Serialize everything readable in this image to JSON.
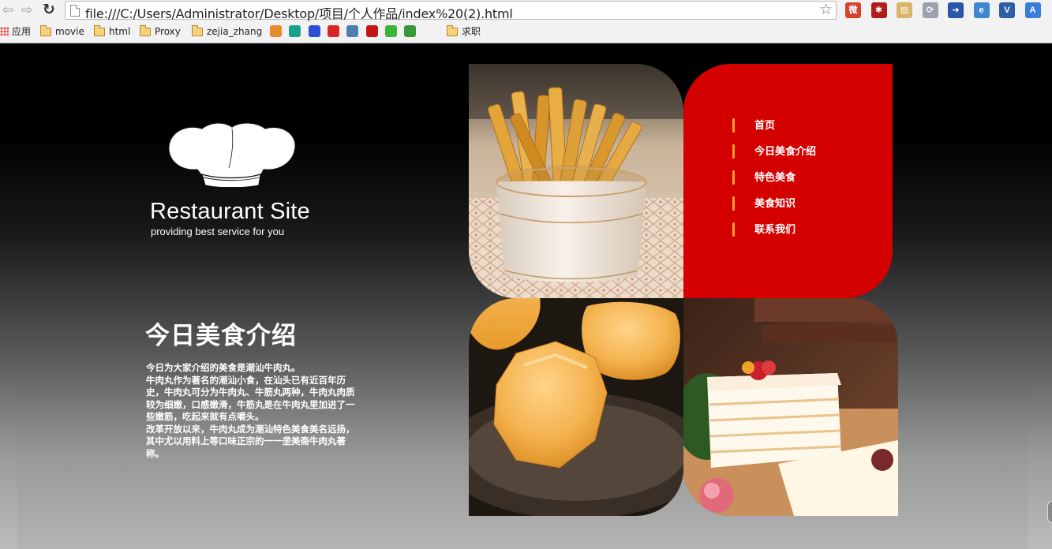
{
  "browser": {
    "url": "file:///C:/Users/Administrator/Desktop/项目/个人作品/index%20(2).html",
    "back_icon": "back-arrow-icon",
    "forward_icon": "forward-arrow-icon",
    "reload_icon": "reload-icon",
    "star_icon": "star-icon",
    "extensions": [
      {
        "name": "weibo-extension-icon",
        "color": "#d9412e",
        "glyph": "微"
      },
      {
        "name": "lastpass-extension-icon",
        "color": "#b01c1c",
        "glyph": "✱"
      },
      {
        "name": "notes-extension-icon",
        "color": "#d9b46a",
        "glyph": "▤"
      },
      {
        "name": "sync-extension-icon",
        "color": "#9aa3ad",
        "glyph": "⟳"
      },
      {
        "name": "share-extension-icon",
        "color": "#2a56a8",
        "glyph": "➜"
      },
      {
        "name": "ie-tab-extension-icon",
        "color": "#3f86d0",
        "glyph": "e"
      },
      {
        "name": "vue-extension-icon",
        "color": "#2b5fa8",
        "glyph": "V"
      },
      {
        "name": "translate-extension-icon",
        "color": "#3b7ddd",
        "glyph": "A"
      }
    ]
  },
  "bookmarks": {
    "items": [
      {
        "label": "应用",
        "type": "apps"
      },
      {
        "label": "movie",
        "type": "folder"
      },
      {
        "label": "html",
        "type": "folder"
      },
      {
        "label": "Proxy",
        "type": "folder"
      },
      {
        "label": "zejia_zhang",
        "type": "folder"
      },
      {
        "label": "求职",
        "type": "folder"
      }
    ],
    "site_icons": [
      {
        "name": "bookmark-site-icon-1",
        "color": "#e68a2e"
      },
      {
        "name": "bookmark-site-icon-2",
        "color": "#1aa08c"
      },
      {
        "name": "bookmark-site-icon-baidu",
        "color": "#2d4fd6"
      },
      {
        "name": "bookmark-site-icon-3",
        "color": "#d92525"
      },
      {
        "name": "bookmark-site-icon-4",
        "color": "#4e7fb3"
      },
      {
        "name": "bookmark-site-icon-5",
        "color": "#c41616"
      },
      {
        "name": "bookmark-site-icon-wechat",
        "color": "#3ab53a"
      },
      {
        "name": "bookmark-site-icon-6",
        "color": "#3a9a3a"
      }
    ]
  },
  "logo": {
    "name": "Restaurant  Site",
    "tagline": "providing best service for you",
    "icon": "chef-hat-icon"
  },
  "intro": {
    "title": "今日美食介绍",
    "paragraphs": [
      "今日为大家介绍的美食是潮汕牛肉丸。",
      "牛肉丸作为著名的潮汕小食，在汕头已有近百年历史，牛肉丸可分为牛肉丸、牛筋丸两种，牛肉丸肉质较为细嫩，口感嫩滑，牛筋丸是在牛肉丸里加进了一些嫩筋，吃起来就有点嚼头。",
      "改革开放以来，牛肉丸成为潮汕特色美食美名远扬，其中尤以用料上等口味正宗的一一垄美斋牛肉丸著称。"
    ]
  },
  "nav": {
    "items": [
      "首页",
      "今日美食介绍",
      "特色美食",
      "美食知识",
      "联系我们"
    ]
  },
  "colors": {
    "nav_background": "#d40000",
    "nav_bar_accent": "#f0a030"
  }
}
